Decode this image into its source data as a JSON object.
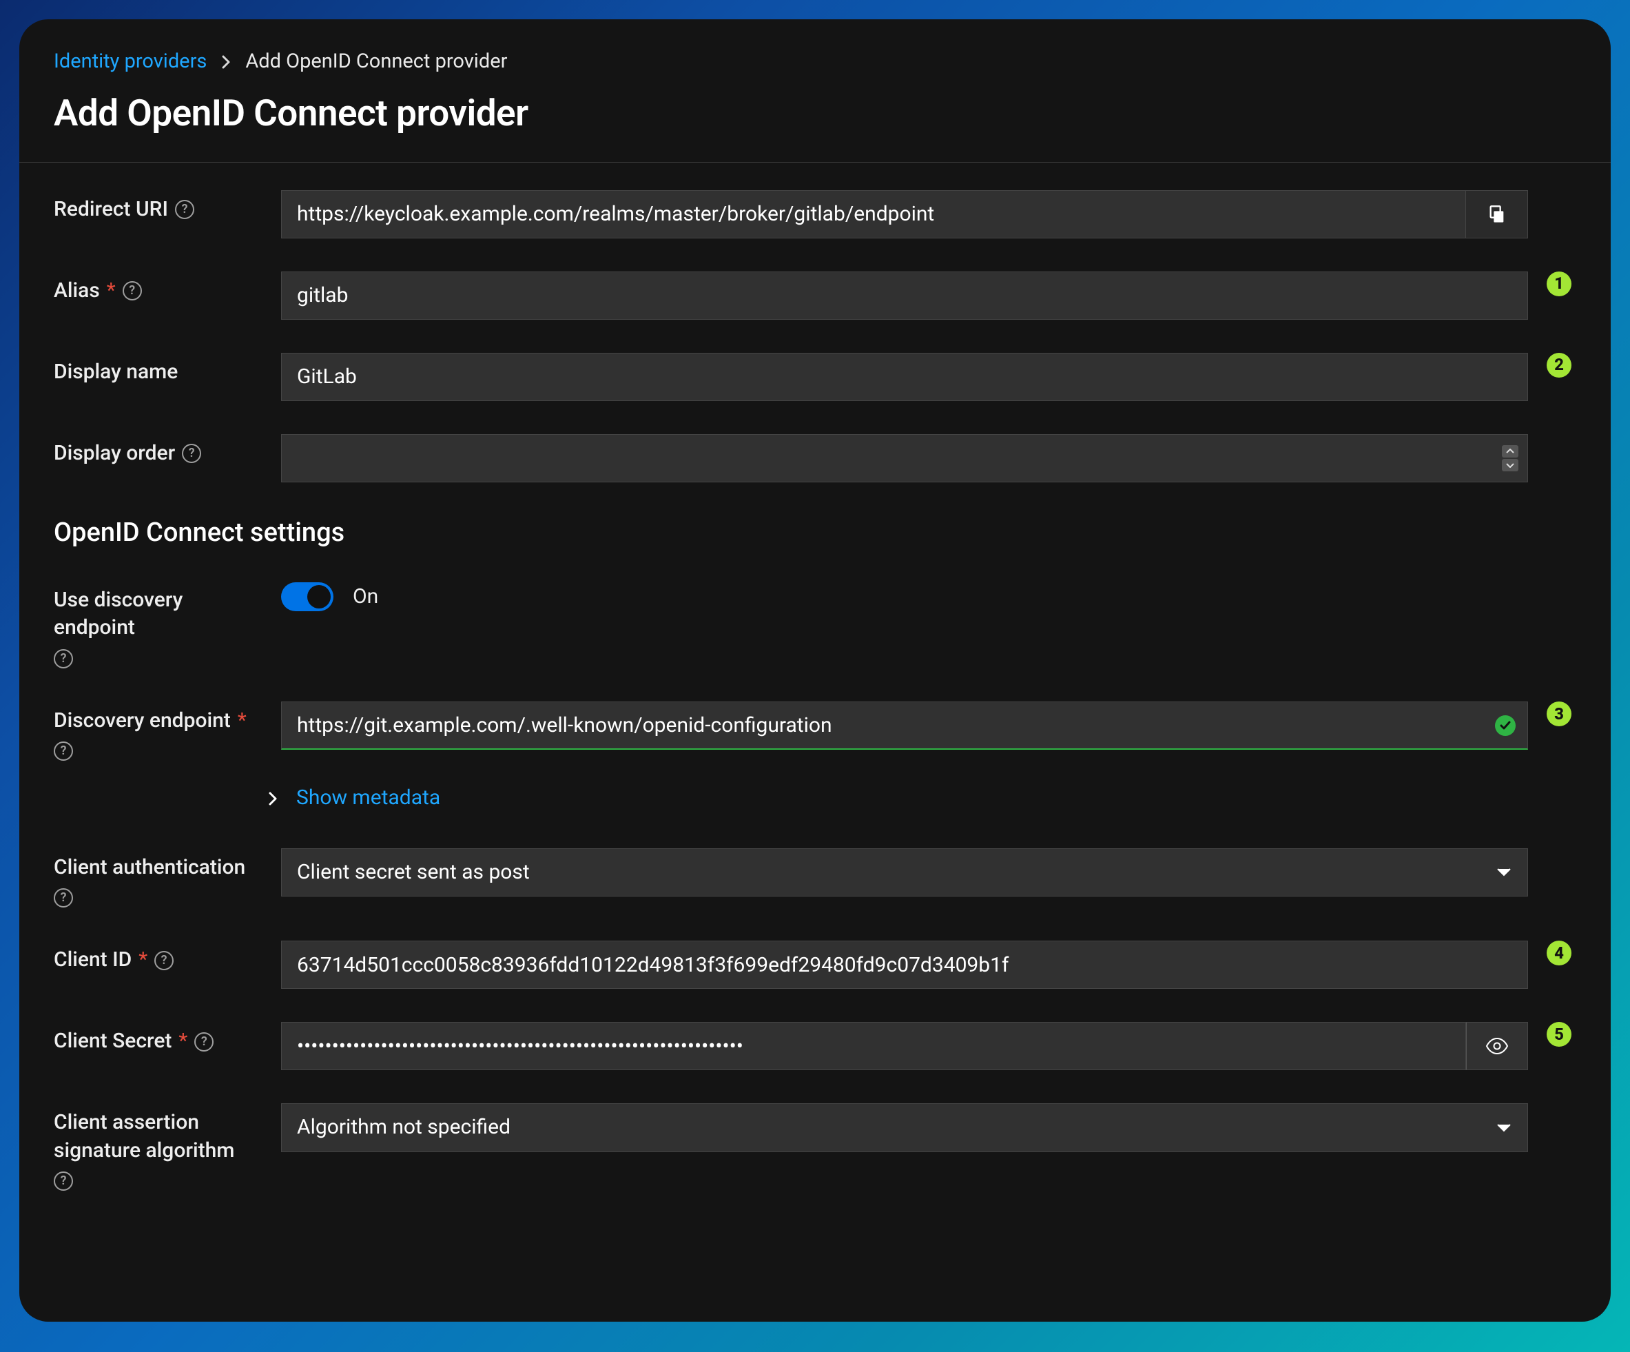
{
  "breadcrumb": {
    "parent": "Identity providers",
    "current": "Add OpenID Connect provider"
  },
  "page_title": "Add OpenID Connect provider",
  "fields": {
    "redirect_uri": {
      "label": "Redirect URI",
      "value": "https://keycloak.example.com/realms/master/broker/gitlab/endpoint"
    },
    "alias": {
      "label": "Alias",
      "value": "gitlab"
    },
    "display_name": {
      "label": "Display name",
      "value": "GitLab"
    },
    "display_order": {
      "label": "Display order",
      "value": ""
    }
  },
  "section_title": "OpenID Connect settings",
  "discovery": {
    "use_label": "Use discovery endpoint",
    "toggle_state": "On",
    "endpoint_label": "Discovery endpoint",
    "endpoint_value": "https://git.example.com/.well-known/openid-configuration",
    "show_metadata": "Show metadata"
  },
  "client": {
    "auth_label": "Client authentication",
    "auth_value": "Client secret sent as post",
    "id_label": "Client ID",
    "id_value": "63714d501ccc0058c83936fdd10122d49813f3f699edf29480fd9c07d3409b1f",
    "secret_label": "Client Secret",
    "secret_value": "••••••••••••••••••••••••••••••••••••••••••••••••••••••••••••••••",
    "algo_label": "Client assertion signature algorithm",
    "algo_value": "Algorithm not specified"
  },
  "badges": {
    "b1": "1",
    "b2": "2",
    "b3": "3",
    "b4": "4",
    "b5": "5"
  }
}
